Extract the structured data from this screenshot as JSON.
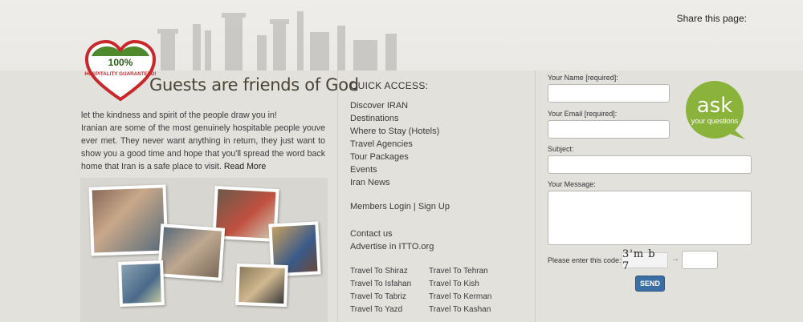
{
  "header": {
    "share_label": "Share this page:"
  },
  "badge": {
    "percent": "100%",
    "text": "HOSPITALITY GUARANTEED!",
    "colors": {
      "green": "#4e8a2c",
      "red": "#c8282a"
    }
  },
  "intro": {
    "title": "Guests are friends of God",
    "line1": "let the kindness and spirit of the people draw you in!",
    "body": "Iranian are some of the most genuinely hospitable people youve ever met. They never want anything in return, they just want to show you a good time and hope that you'll spread the word back home that Iran is a safe place to visit.",
    "read_more": "Read More"
  },
  "quick_access": {
    "title": "QUICK ACCESS:",
    "links": [
      "Discover IRAN",
      "Destinations",
      "Where to Stay (Hotels)",
      "Travel Agencies",
      "Tour Packages",
      "Events",
      "Iran News"
    ],
    "members_login": "Members Login",
    "separator": "|",
    "sign_up": "Sign Up",
    "contact_us": "Contact us",
    "advertise": "Advertise in ITTO.org"
  },
  "travel_links": {
    "col1": [
      "Travel To Shiraz",
      "Travel To Isfahan",
      "Travel To Tabriz",
      "Travel To Yazd"
    ],
    "col2": [
      "Travel To Tehran",
      "Travel To Kish",
      "Travel To Kerman",
      "Travel To Kashan"
    ]
  },
  "form": {
    "name_label": "Your Name [required]:",
    "email_label": "Your Email [required]:",
    "subject_label": "Subject:",
    "message_label": "Your Message:",
    "code_label": "Please enter this code:",
    "captcha_text": "3'm b 7",
    "arrow": "→",
    "send_label": "SEND",
    "send_color": "#3a6ea5"
  },
  "ask_bubble": {
    "word": "ask",
    "sub": "your questions",
    "color": "#8ab33c"
  }
}
